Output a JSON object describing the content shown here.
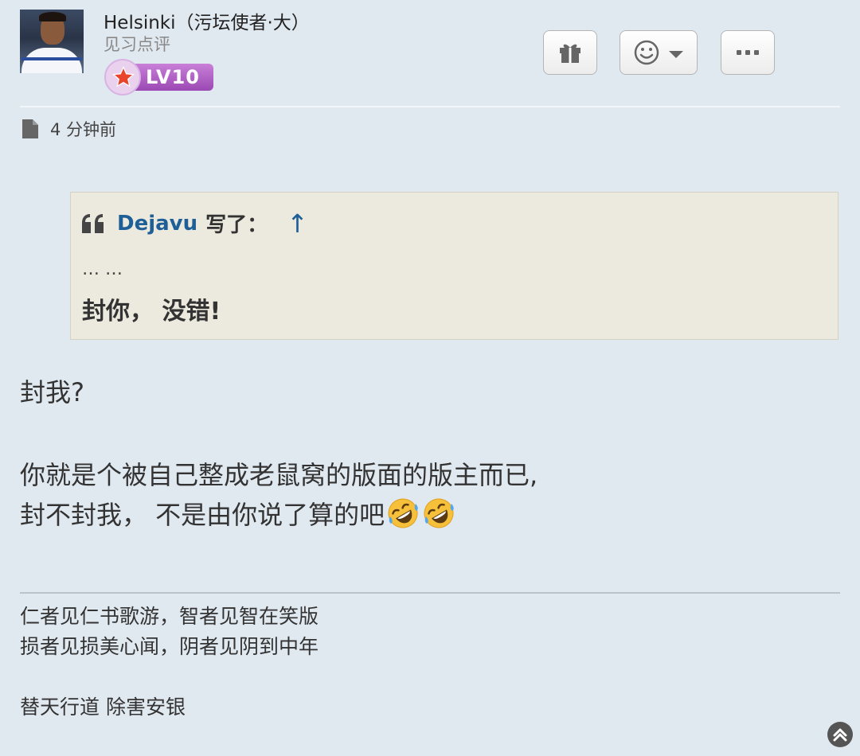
{
  "post": {
    "author": {
      "name": "Helsinki（污坛使者·大）",
      "title": "见习点评",
      "level": "LV10"
    },
    "time": "4 分钟前",
    "actions": {
      "gift_icon": "gift-icon",
      "react_icon": "smiley-icon",
      "more_icon": "ellipsis-icon"
    },
    "quote": {
      "author": "Dejavu",
      "wrote": "写了：",
      "jump": "↑",
      "ellipsis": "… …",
      "text": "封你， 没错!"
    },
    "body": {
      "line1": "封我?",
      "line2": "你就是个被自己整成老鼠窝的版面的版主而已,",
      "line3": "封不封我， 不是由你说了算的吧",
      "emoji_icon": "rofl-emoji"
    },
    "signature": {
      "line1": "仁者见仁书歌游，智者见智在笑版",
      "line2": "损者见损美心闻，阴者见阴到中年",
      "line3": "替天行道 除害安银"
    }
  },
  "colors": {
    "background": "#e1e9f0",
    "quote_background": "#ece9de",
    "link": "#1f5f98",
    "level_badge": "#b565c9"
  }
}
